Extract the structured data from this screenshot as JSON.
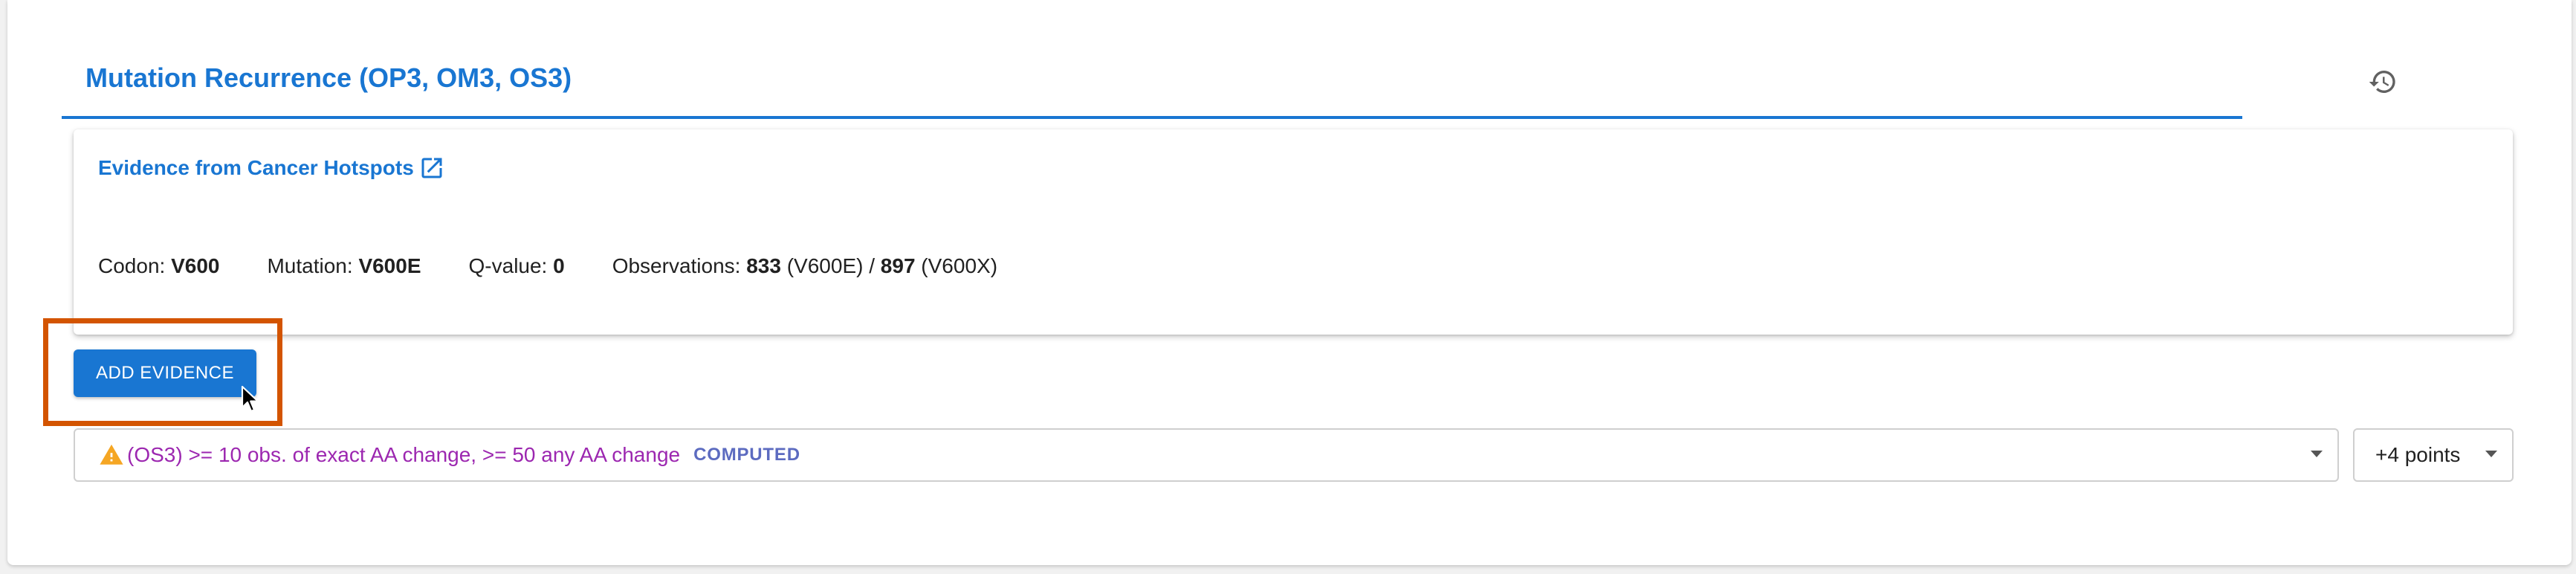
{
  "section": {
    "title": "Mutation Recurrence (OP3, OM3, OS3)",
    "history_icon": "history-icon"
  },
  "evidence_card": {
    "link_label": "Evidence from Cancer Hotspots",
    "link_icon": "external-link-icon",
    "codon_label": "Codon:",
    "codon_value": "V600",
    "mutation_label": "Mutation:",
    "mutation_value": "V600E",
    "qvalue_label": "Q-value:",
    "qvalue_value": "0",
    "observations_label": "Observations:",
    "obs_exact_value": "833",
    "obs_exact_variant": "(V600E)",
    "obs_separator": "/",
    "obs_any_value": "897",
    "obs_any_variant": "(V600X)"
  },
  "add_evidence_button": {
    "label": "ADD EVIDENCE"
  },
  "criteria_select": {
    "icon": "warning-icon",
    "value": "(OS3) >= 10 obs. of exact AA change, >= 50 any AA change",
    "badge": "COMPUTED"
  },
  "points_select": {
    "value": "+4 points"
  },
  "colors": {
    "accent": "#1976d2",
    "highlight_box": "#d35400",
    "rule_text": "#9c27b0",
    "badge_text": "#5c6bc0",
    "warning": "#f5a623"
  }
}
